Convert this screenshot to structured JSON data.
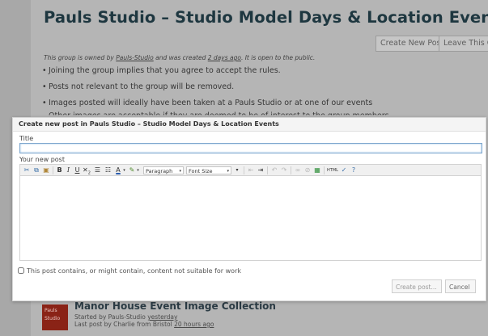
{
  "group": {
    "title": "Pauls Studio – Studio Model Days & Location Events",
    "buttons": {
      "create_post": "Create New Post",
      "leave": "Leave This G"
    },
    "owner_line": {
      "prefix": "This group is owned by ",
      "owner": "Pauls-Studio",
      "middle": " and was created ",
      "created": "2 days ago",
      "suffix": ". It is open to the public."
    },
    "rules": [
      "Joining the group implies that you agree to accept the rules.",
      "Posts not relevant to the group will be removed.",
      "Images posted will ideally have been taken at a Pauls Studio or at one of our events",
      "Other images are acceptable if they are deemed to be of interest to the group members"
    ]
  },
  "thread": {
    "thumb_text": "Pauls Studio",
    "title": "Manor House Event Image Collection",
    "started_prefix": "Started by ",
    "started_by": "Pauls-Studio",
    "started_when": "yesterday",
    "last_prefix": "Last post by ",
    "last_by": "Charlie from Bristol",
    "last_when": "20 hours ago"
  },
  "dialog": {
    "title": "Create new post in Pauls Studio – Studio Model Days & Location Events",
    "title_label": "Title",
    "title_value": "",
    "post_label": "Your new post",
    "toolbar": {
      "format_select": "Paragraph",
      "font_size_select": "Font Size",
      "html_label": "HTML"
    },
    "nsfw_label": "This post contains, or might contain, content not suitable for work",
    "create_button": "Create post...",
    "cancel_button": "Cancel"
  },
  "colors": {
    "title": "#1e3740",
    "input_focus": "#7fa8cf",
    "thumb": "#8a2316",
    "overlay": "#9a9a9a"
  }
}
